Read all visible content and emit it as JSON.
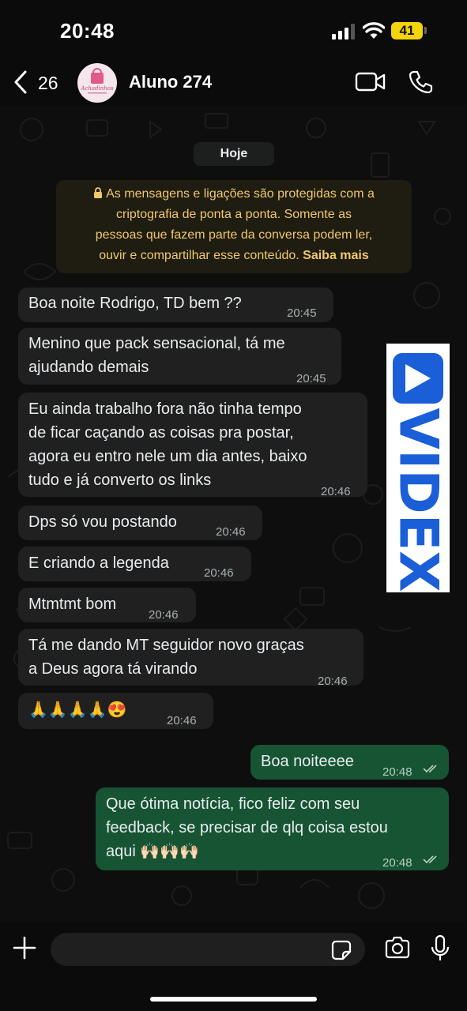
{
  "status": {
    "time": "20:48",
    "battery": "41"
  },
  "header": {
    "back_count": "26",
    "contact_name": "Aluno 274",
    "avatar_text": "Achadinhos"
  },
  "chat": {
    "date_chip": "Hoje",
    "encryption_notice": {
      "lines": [
        "As mensagens e ligações são protegidas com a",
        "criptografia de ponta a ponta. Somente as",
        "pessoas que fazem parte da conversa podem ler,",
        "ouvir e compartilhar esse conteúdo."
      ],
      "link": "Saiba mais"
    },
    "messages": [
      {
        "dir": "in",
        "lines": [
          "Boa noite Rodrigo, TD bem ??"
        ],
        "time": "20:45"
      },
      {
        "dir": "in",
        "lines": [
          "Menino que pack sensacional, tá me",
          "ajudando demais"
        ],
        "time": "20:45"
      },
      {
        "dir": "in",
        "lines": [
          "Eu ainda trabalho fora não tinha tempo",
          "de ficar caçando as coisas pra postar,",
          "agora eu entro nele um dia antes, baixo",
          "tudo e já converto os links"
        ],
        "time": "20:46"
      },
      {
        "dir": "in",
        "lines": [
          "Dps só vou postando"
        ],
        "time": "20:46"
      },
      {
        "dir": "in",
        "lines": [
          "E criando a legenda"
        ],
        "time": "20:46"
      },
      {
        "dir": "in",
        "lines": [
          "Mtmtmt bom"
        ],
        "time": "20:46"
      },
      {
        "dir": "in",
        "lines": [
          "Tá me dando MT seguidor novo graças",
          "a Deus agora tá virando"
        ],
        "time": "20:46"
      },
      {
        "dir": "in",
        "lines": [
          "🙏🙏🙏🙏😍"
        ],
        "time": "20:46"
      },
      {
        "dir": "out",
        "lines": [
          "Boa noiteeee"
        ],
        "time": "20:48",
        "status": "read"
      },
      {
        "dir": "out",
        "lines": [
          "Que ótima notícia, fico feliz com seu",
          "feedback, se precisar de qlq coisa estou",
          "aqui 🙌🏻🙌🏻🙌🏻"
        ],
        "time": "20:48",
        "status": "read"
      }
    ]
  },
  "watermark": {
    "text": "VIDEX",
    "color": "#1a5fd8"
  },
  "composer": {
    "placeholder": ""
  },
  "icons": [
    "chevron-left-icon",
    "video-camera-icon",
    "phone-icon",
    "plus-icon",
    "sticker-icon",
    "camera-icon",
    "microphone-icon",
    "lock-icon",
    "double-check-icon"
  ],
  "colors": {
    "incoming_bubble": "#202020",
    "outgoing_bubble": "#175434",
    "notice_text": "#f0c96a",
    "background": "#0e0e0e"
  }
}
